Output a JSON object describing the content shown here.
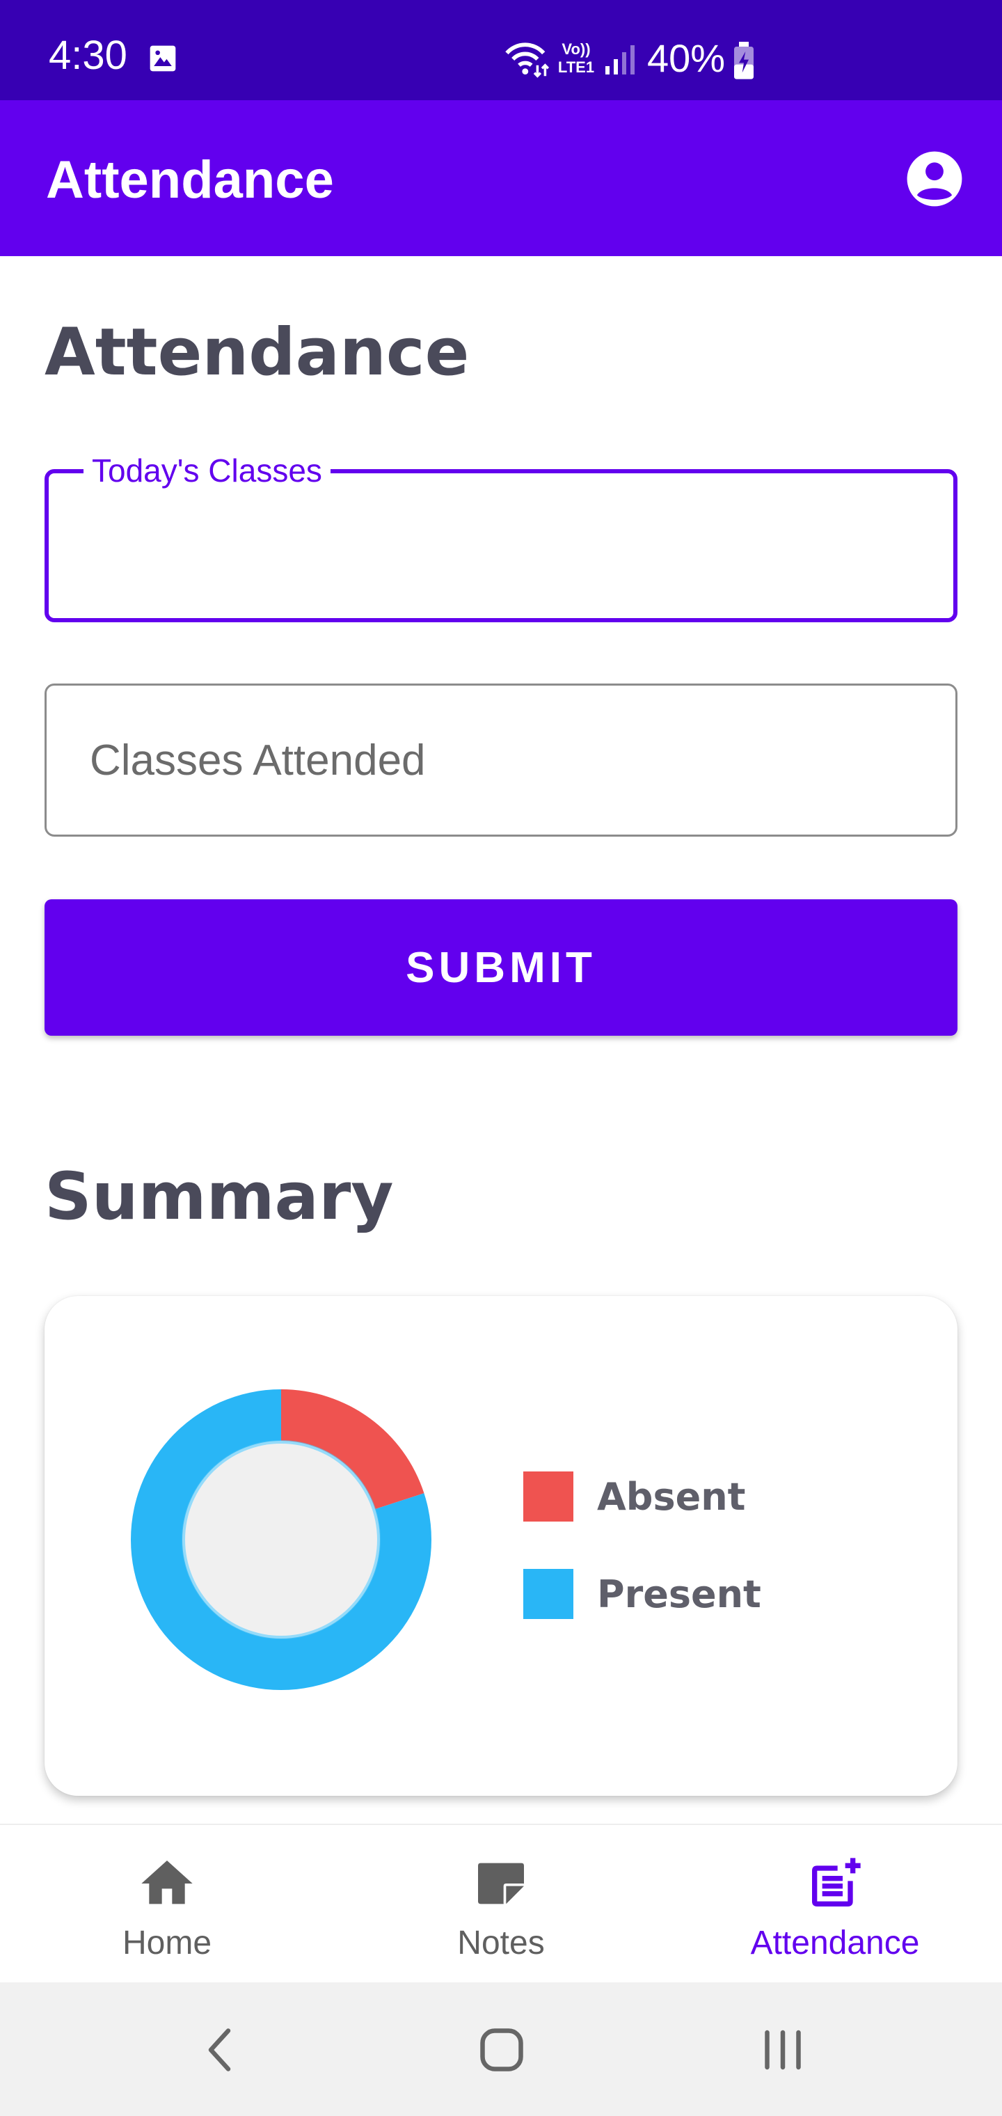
{
  "status_bar": {
    "time": "4:30",
    "volte_line1": "Vo))",
    "volte_line2": "LTE1",
    "battery": "40%",
    "icons": [
      "gallery-icon",
      "wifi-icon",
      "volte-icon",
      "signal-icon",
      "battery-charging-icon"
    ]
  },
  "app_bar": {
    "title": "Attendance",
    "account_icon": "account-circle-icon"
  },
  "form": {
    "heading": "Attendance",
    "todays_classes": {
      "label": "Today's Classes",
      "value": ""
    },
    "classes_attended": {
      "placeholder": "Classes Attended",
      "value": ""
    },
    "submit_label": "SUBMIT"
  },
  "summary": {
    "heading": "Summary"
  },
  "chart_data": {
    "type": "pie",
    "variant": "donut",
    "categories": [
      "Absent",
      "Present"
    ],
    "values": [
      20,
      80
    ],
    "colors": [
      "#EF5350",
      "#29B6F6"
    ],
    "legend_position": "right"
  },
  "bottom_nav": {
    "items": [
      {
        "label": "Home",
        "icon": "home-icon",
        "active": false
      },
      {
        "label": "Notes",
        "icon": "note-icon",
        "active": false
      },
      {
        "label": "Attendance",
        "icon": "post-add-icon",
        "active": true
      }
    ]
  },
  "system_nav": {
    "icons": [
      "back-icon",
      "home-circle-icon",
      "recents-icon"
    ]
  },
  "colors": {
    "primary": "#6200EE",
    "primary_dark": "#3700B3",
    "absent": "#EF5350",
    "present": "#29B6F6",
    "heading_text": "#4a4a5a"
  }
}
